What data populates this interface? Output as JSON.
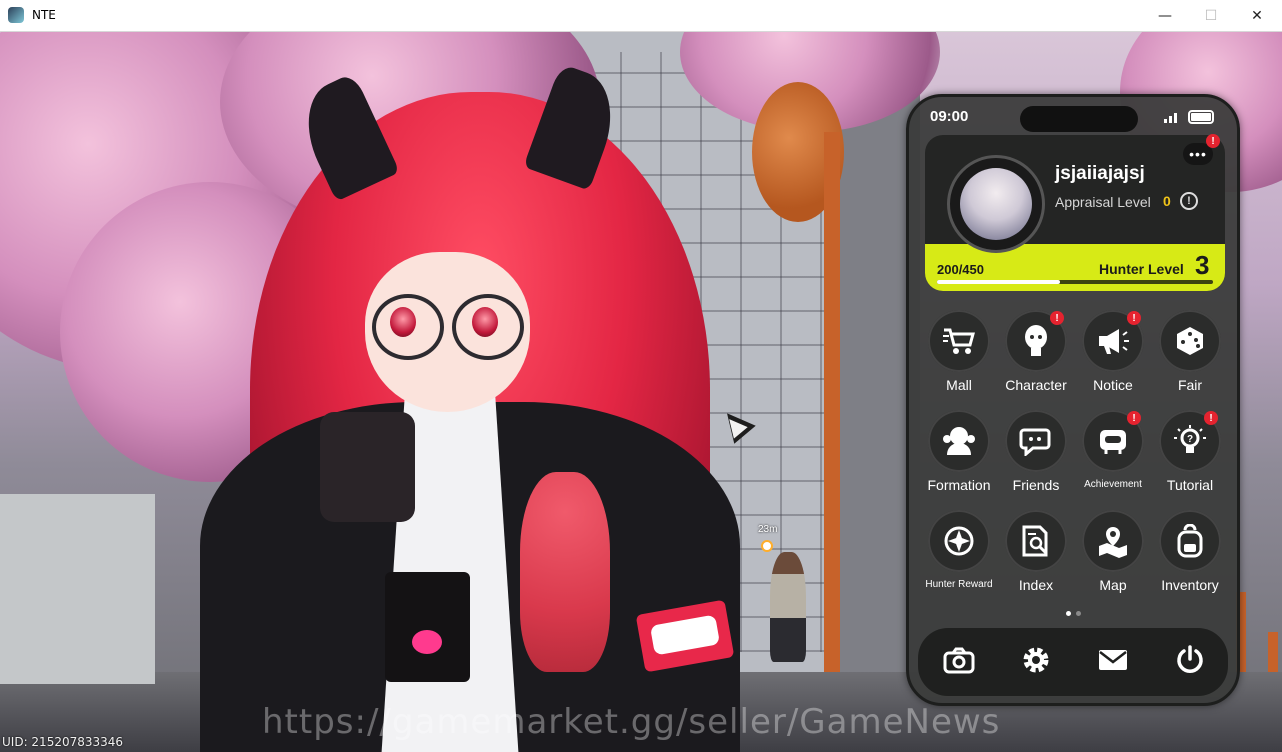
{
  "window": {
    "title": "NTE",
    "min_label": "—",
    "max_label": "☐",
    "close_label": "✕"
  },
  "scene": {
    "watermark": "https://gamemarket.gg/seller/GameNews",
    "uid": "UID: 215207833346",
    "npc_distance": "23m"
  },
  "phone": {
    "time": "09:00",
    "profile": {
      "username": "jsjaiiajajsj",
      "appraisal_label": "Appraisal Level",
      "appraisal_value": "0",
      "info_glyph": "!",
      "more_glyph": "•••",
      "xp_current": 200,
      "xp_max": 450,
      "xp_text": "200/450",
      "hunter_label": "Hunter Level",
      "hunter_value": "3",
      "more_badge": true
    },
    "apps": [
      {
        "label": "Mall",
        "icon": "cart-icon",
        "badge": false,
        "small": false
      },
      {
        "label": "Character",
        "icon": "character-icon",
        "badge": true,
        "small": false
      },
      {
        "label": "Notice",
        "icon": "megaphone-icon",
        "badge": true,
        "small": false
      },
      {
        "label": "Fair",
        "icon": "dice-icon",
        "badge": false,
        "small": false
      },
      {
        "label": "Formation",
        "icon": "formation-icon",
        "badge": false,
        "small": false
      },
      {
        "label": "Friends",
        "icon": "chat-icon",
        "badge": false,
        "small": false
      },
      {
        "label": "Achievement",
        "icon": "robot-icon",
        "badge": true,
        "small": true
      },
      {
        "label": "Tutorial",
        "icon": "lightbulb-icon",
        "badge": true,
        "small": false
      },
      {
        "label": "Hunter Reward",
        "icon": "compass-icon",
        "badge": false,
        "small": true
      },
      {
        "label": "Index",
        "icon": "index-search-icon",
        "badge": false,
        "small": false
      },
      {
        "label": "Map",
        "icon": "map-icon",
        "badge": false,
        "small": false
      },
      {
        "label": "Inventory",
        "icon": "backpack-icon",
        "badge": false,
        "small": false
      }
    ],
    "page_indicator": {
      "count": 2,
      "active": 1
    },
    "dock": [
      {
        "name": "camera-icon"
      },
      {
        "name": "settings-gear-icon"
      },
      {
        "name": "mail-icon"
      },
      {
        "name": "power-icon"
      }
    ],
    "colors": {
      "accent": "#d7ea16",
      "badge": "#e5232f",
      "appraisal": "#f0c419"
    }
  }
}
